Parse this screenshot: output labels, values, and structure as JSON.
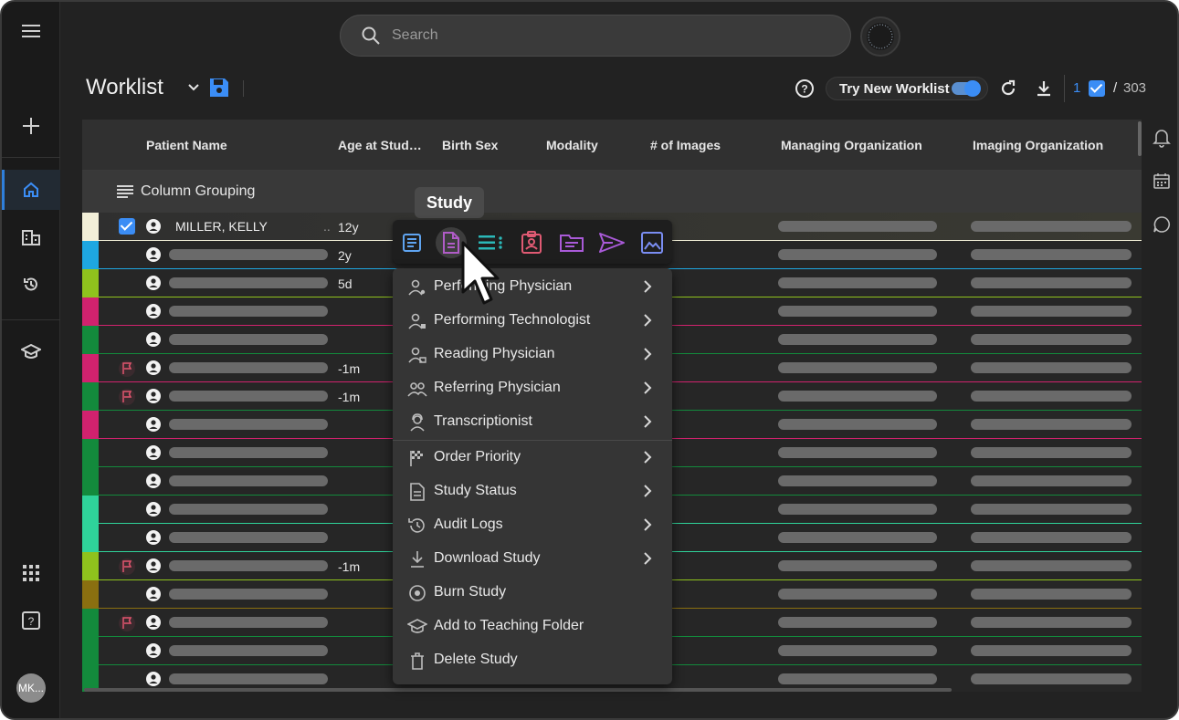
{
  "search": {
    "placeholder": "Search"
  },
  "page": {
    "title": "Worklist"
  },
  "toolbar": {
    "try_new_label": "Try New Worklist",
    "selected_count": "1",
    "separator": "/",
    "total_count": "303"
  },
  "grid": {
    "columns": [
      "Patient Name",
      "Age at Stud…",
      "Birth Sex",
      "Modality",
      "# of Images",
      "Managing Organization",
      "Imaging Organization"
    ],
    "column_grouping_label": "Column Grouping",
    "rows": [
      {
        "stripe": "#f2efd8",
        "selected": true,
        "flag": false,
        "name": "MILLER, KELLY",
        "name_suffix": "..",
        "age": "12y"
      },
      {
        "stripe": "#1ea7e1",
        "selected": false,
        "flag": false,
        "name": "",
        "age": "2y"
      },
      {
        "stripe": "#8fc21d",
        "selected": false,
        "flag": false,
        "name": "",
        "age": "5d"
      },
      {
        "stripe": "#d1226e",
        "selected": false,
        "flag": false,
        "name": "",
        "age": ""
      },
      {
        "stripe": "#138a3c",
        "selected": false,
        "flag": false,
        "name": "",
        "age": ""
      },
      {
        "stripe": "#d1226e",
        "selected": false,
        "flag": true,
        "name": "",
        "age": "-1m"
      },
      {
        "stripe": "#138a3c",
        "selected": false,
        "flag": true,
        "name": "",
        "age": "-1m"
      },
      {
        "stripe": "#d1226e",
        "selected": false,
        "flag": false,
        "name": "",
        "age": ""
      },
      {
        "stripe": "#138a3c",
        "selected": false,
        "flag": false,
        "name": "",
        "age": ""
      },
      {
        "stripe": "#138a3c",
        "selected": false,
        "flag": false,
        "name": "",
        "age": ""
      },
      {
        "stripe": "#2fd39a",
        "selected": false,
        "flag": false,
        "name": "",
        "age": ""
      },
      {
        "stripe": "#2fd39a",
        "selected": false,
        "flag": false,
        "name": "",
        "age": ""
      },
      {
        "stripe": "#8fc21d",
        "selected": false,
        "flag": true,
        "name": "",
        "age": "-1m"
      },
      {
        "stripe": "#8a6f10",
        "selected": false,
        "flag": false,
        "name": "",
        "age": ""
      },
      {
        "stripe": "#138a3c",
        "selected": false,
        "flag": true,
        "name": "",
        "age": ""
      },
      {
        "stripe": "#138a3c",
        "selected": false,
        "flag": false,
        "name": "",
        "age": ""
      },
      {
        "stripe": "#138a3c",
        "selected": false,
        "flag": false,
        "name": "",
        "age": ""
      }
    ]
  },
  "context_menu": {
    "tooltip": "Study",
    "toolbar_icons": [
      "study-details-icon",
      "study-report-icon",
      "study-list-icon",
      "patient-card-icon",
      "study-folder-icon",
      "send-icon",
      "image-icon"
    ],
    "items": [
      {
        "label": "Performing Physician",
        "icon": "performing-physician-icon",
        "submenu": true
      },
      {
        "label": "Performing Technologist",
        "icon": "performing-technologist-icon",
        "submenu": true
      },
      {
        "label": "Reading Physician",
        "icon": "reading-physician-icon",
        "submenu": true
      },
      {
        "label": "Referring Physician",
        "icon": "referring-physician-icon",
        "submenu": true
      },
      {
        "label": "Transcriptionist",
        "icon": "transcriptionist-icon",
        "submenu": true
      },
      {
        "label": "Order Priority",
        "icon": "checkered-flag-icon",
        "submenu": true
      },
      {
        "label": "Study Status",
        "icon": "document-icon",
        "submenu": true
      },
      {
        "label": "Audit Logs",
        "icon": "history-icon",
        "submenu": true
      },
      {
        "label": "Download Study",
        "icon": "download-icon",
        "submenu": true
      },
      {
        "label": "Burn Study",
        "icon": "disc-icon",
        "submenu": false
      },
      {
        "label": "Add to Teaching Folder",
        "icon": "graduation-cap-icon",
        "submenu": false
      },
      {
        "label": "Delete Study",
        "icon": "trash-icon",
        "submenu": false
      }
    ]
  },
  "user": {
    "initials": "MK..."
  },
  "colors": {
    "accent": "#3b8df5",
    "background": "#222222",
    "menu": "#353535"
  }
}
